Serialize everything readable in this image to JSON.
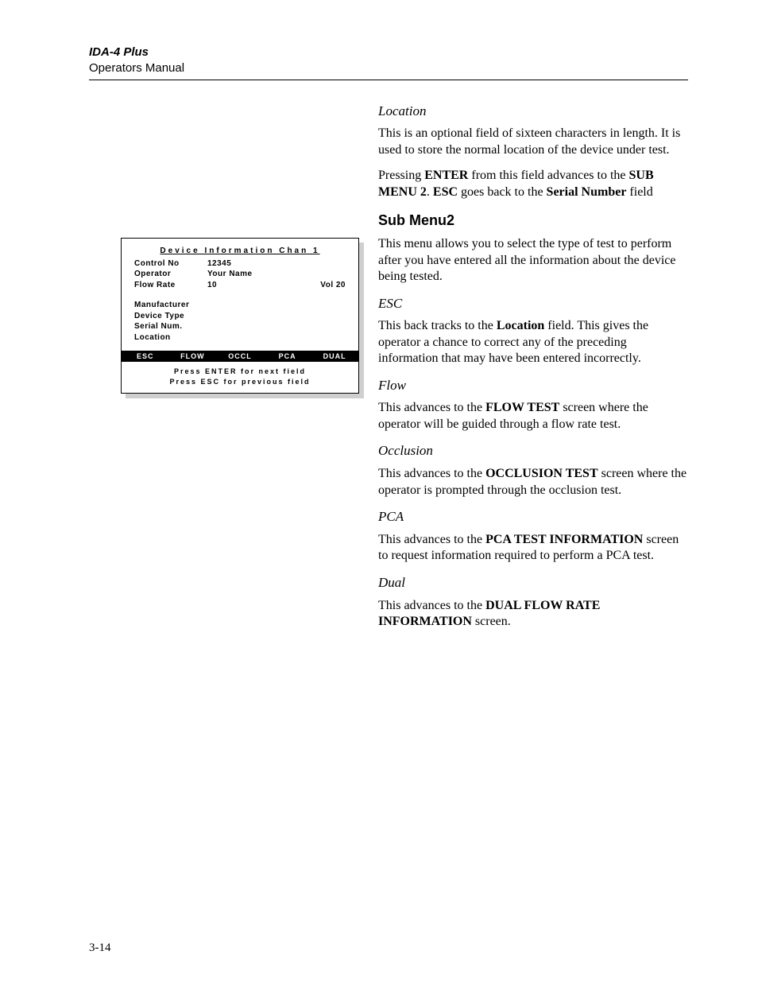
{
  "header": {
    "product": "IDA-4 Plus",
    "manual": "Operators Manual"
  },
  "page_number": "3-14",
  "device_screen": {
    "title": "Device Information Chan 1",
    "rows": [
      {
        "label": "Control No",
        "value": "12345",
        "right": ""
      },
      {
        "label": "Operator",
        "value": "Your Name",
        "right": ""
      },
      {
        "label": "Flow Rate",
        "value": "10",
        "right": "Vol 20"
      }
    ],
    "blank_rows": [
      {
        "label": "Manufacturer"
      },
      {
        "label": "Device Type"
      },
      {
        "label": "Serial Num."
      },
      {
        "label": "Location"
      }
    ],
    "menu": [
      "ESC",
      "FLOW",
      "OCCL",
      "PCA",
      "DUAL"
    ],
    "hint1": "Press ENTER for next field",
    "hint2": "Press ESC for previous field"
  },
  "body": {
    "location_h": "Location",
    "location_p1": "This is an optional field of sixteen characters in length. It is used to store the normal location of the device under test.",
    "location_p2a": "Pressing ",
    "location_p2b": "ENTER",
    "location_p2c": " from this field advances to the ",
    "location_p2d": "SUB MENU 2",
    "location_p2e": ".  ",
    "location_p2f": "ESC",
    "location_p2g": " goes back to the ",
    "location_p2h": "Serial Number",
    "location_p2i": " field",
    "submenu_h": "Sub Menu2",
    "submenu_p": "This menu allows you to select the type of test to perform after you have entered all the information about the device being tested.",
    "esc_h": "ESC",
    "esc_pa": "This back tracks to the ",
    "esc_pb": "Location",
    "esc_pc": " field. This gives the operator a chance to correct any of the preceding information that may have been entered incorrectly.",
    "flow_h": "Flow",
    "flow_pa": "This advances to the ",
    "flow_pb": "FLOW TEST",
    "flow_pc": " screen where the operator will be guided through a flow rate test.",
    "occl_h": "Occlusion",
    "occl_pa": "This advances to the ",
    "occl_pb": "OCCLUSION TEST",
    "occl_pc": " screen where the operator is prompted through the occlusion test.",
    "pca_h": "PCA",
    "pca_pa": "This advances to the ",
    "pca_pb": "PCA TEST INFORMATION",
    "pca_pc": " screen to request information required to perform a PCA test.",
    "dual_h": "Dual",
    "dual_pa": "This advances to the ",
    "dual_pb": "DUAL FLOW RATE INFORMATION",
    "dual_pc": " screen."
  }
}
